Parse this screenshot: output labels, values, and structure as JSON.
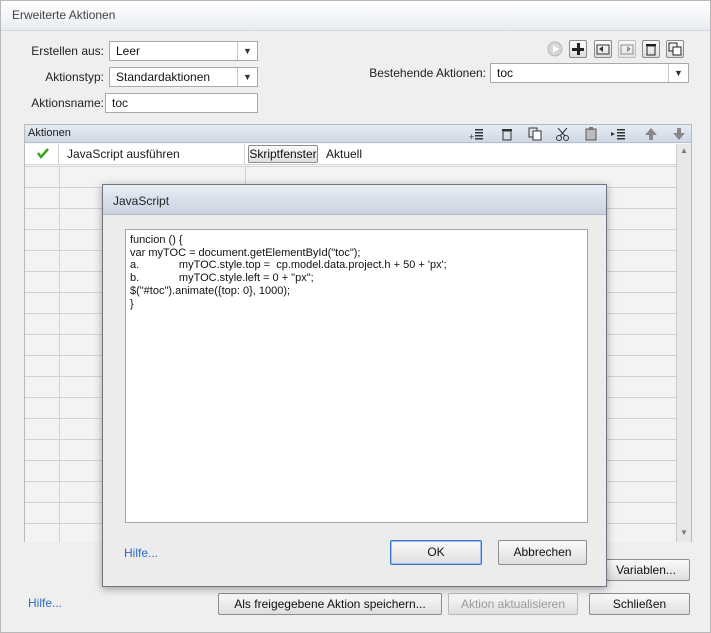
{
  "window": {
    "title": "Erweiterte Aktionen"
  },
  "form": {
    "erstellen_label": "Erstellen aus:",
    "erstellen_value": "Leer",
    "aktionstyp_label": "Aktionstyp:",
    "aktionstyp_value": "Standardaktionen",
    "aktionsname_label": "Aktionsname:",
    "aktionsname_value": "toc",
    "bestehende_label": "Bestehende Aktionen:",
    "bestehende_value": "toc"
  },
  "actions_panel": {
    "header": "Aktionen",
    "row1": {
      "action": "JavaScript ausführen",
      "button": "Skriptfenster",
      "target": "Aktuell"
    }
  },
  "dialog": {
    "title": "JavaScript",
    "code": "funcion () {\nvar myTOC = document.getElementById(\"toc\");\na.\t\tmyTOC.style.top =  cp.model.data.project.h + 50 + 'px';\nb.\t\tmyTOC.style.left = 0 + \"px\";\n$(\"#toc\").animate({top: 0}, 1000);\n}",
    "help": "Hilfe...",
    "ok": "OK",
    "cancel": "Abbrechen"
  },
  "footer": {
    "help": "Hilfe...",
    "variables": "Variablen...",
    "save_shared": "Als freigegebene Aktion speichern...",
    "update": "Aktion aktualisieren",
    "close": "Schließen"
  },
  "icons": {
    "top_toolbar": [
      "play-icon",
      "add-icon",
      "import-icon",
      "export-icon",
      "delete-icon",
      "duplicate-icon"
    ],
    "panel_toolbar": [
      "insert-icon",
      "delete-icon",
      "copy-icon",
      "cut-icon",
      "paste-icon",
      "insert-after-icon",
      "move-up-icon",
      "move-down-icon"
    ]
  },
  "colors": {
    "check": "#3aa31f",
    "link": "#2a6cc6",
    "panel_header": "#cfd8e5"
  }
}
